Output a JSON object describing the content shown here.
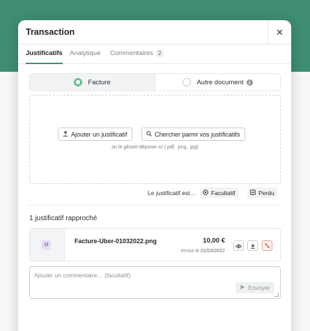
{
  "modal": {
    "title": "Transaction",
    "close_label": "✕"
  },
  "tabs": [
    {
      "label": "Justificatifs",
      "active": true
    },
    {
      "label": "Analytique",
      "active": false
    },
    {
      "label": "Commentaires",
      "count": "2",
      "active": false
    }
  ],
  "doc_type": {
    "options": [
      {
        "label": "Facture",
        "selected": true
      },
      {
        "label": "Autre document",
        "selected": false,
        "icon": "info-icon"
      }
    ]
  },
  "dropzone": {
    "add_button": "Ajouter un justificatif",
    "search_button": "Chercher parmi vos justificatifs",
    "hint": "ou le glisser-déposer ici (.pdf, .png, .jpg)"
  },
  "receipt_status": {
    "label": "Le justificatif est…",
    "optional_label": "Facultatif",
    "lost_label": "Perdu"
  },
  "matched": {
    "title": "1 justificatif rapproché",
    "files": [
      {
        "avatar": "U",
        "name": "Facture-Uber-01032022.png",
        "amount": "10,00 €",
        "issued_prefix": "émise le",
        "issued_date": "01/03/2022",
        "actions": [
          "eye-icon",
          "download-icon",
          "unlink-icon"
        ]
      }
    ]
  },
  "comment": {
    "placeholder": "Ajouter un commentaire… (facultatif)",
    "send_label": "Envoyer"
  },
  "colors": {
    "brand": "#3f8d73",
    "radio_selected": "#63c28b",
    "danger": "#d9534f",
    "avatar_bg": "#e4dcf7",
    "avatar_text": "#6d4fc4"
  }
}
